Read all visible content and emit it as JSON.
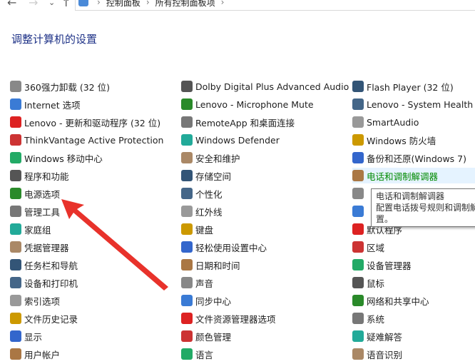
{
  "nav": {
    "back": "←",
    "forward": "→",
    "recent": "⌄",
    "up": "↑"
  },
  "breadcrumb": [
    "控制面板",
    "所有控制面板项"
  ],
  "title": "调整计算机的设置",
  "columns": [
    [
      "360强力卸载 (32 位)",
      "Internet 选项",
      "Lenovo - 更新和驱动程序 (32 位)",
      "ThinkVantage Active Protection",
      "Windows 移动中心",
      "程序和功能",
      "电源选项",
      "管理工具",
      "家庭组",
      "凭据管理器",
      "任务栏和导航",
      "设备和打印机",
      "索引选项",
      "文件历史记录",
      "显示",
      "用户帐户"
    ],
    [
      "Dolby Digital Plus Advanced Audio",
      "Lenovo - Microphone Mute",
      "RemoteApp 和桌面连接",
      "Windows Defender",
      "安全和维护",
      "存储空间",
      "个性化",
      "红外线",
      "键盘",
      "轻松使用设置中心",
      "日期和时间",
      "声音",
      "同步中心",
      "文件资源管理器选项",
      "颜色管理",
      "语言"
    ],
    [
      "Flash Player (32 位)",
      "Lenovo - System Health and",
      "SmartAudio",
      "Windows 防火墙",
      "备份和还原(Windows 7)",
      "电话和调制解调器",
      "",
      "",
      "默认程序",
      "区域",
      "设备管理器",
      "鼠标",
      "网络和共享中心",
      "系统",
      "疑难解答",
      "语音识别"
    ]
  ],
  "icon_colors": [
    "#888",
    "#3a7bd5",
    "#d22",
    "#c33",
    "#2a6",
    "#555",
    "#2a8a2a",
    "#777",
    "#2a9",
    "#a86",
    "#357",
    "#468",
    "#999",
    "#c90",
    "#36c",
    "#a74"
  ],
  "tooltip": {
    "title": "电话和调制解调器",
    "line2": "配置电话拨号规则和调制解",
    "line3": "置。"
  },
  "hover_index": 5
}
